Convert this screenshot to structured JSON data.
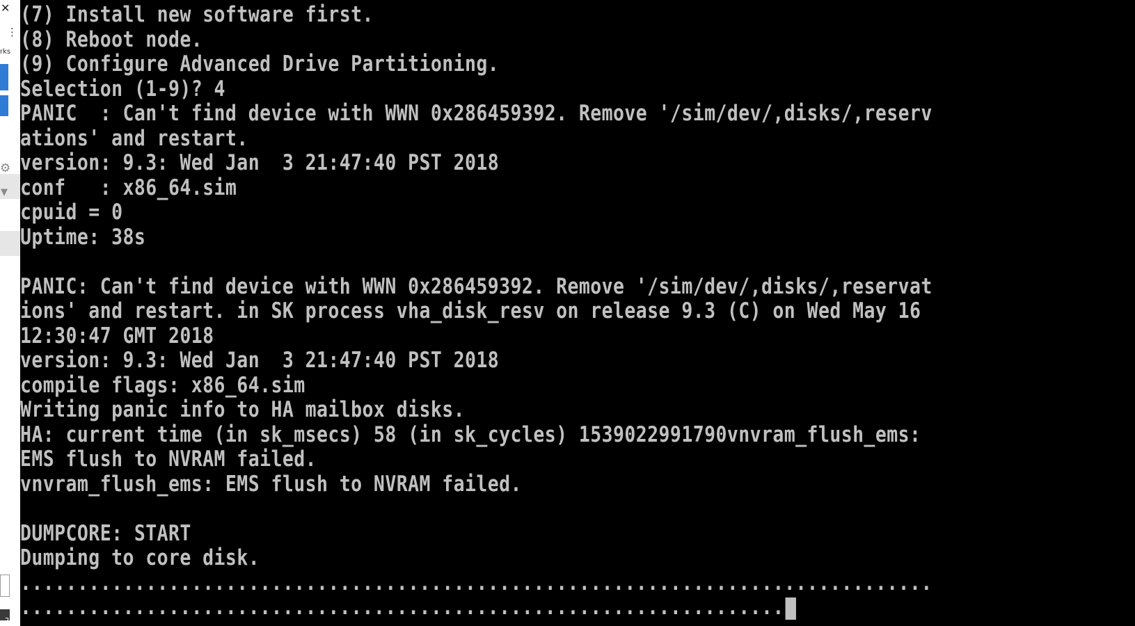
{
  "side_strip": {
    "close_glyph": "✕",
    "menu_glyph": "⋮",
    "label_fragment": "rks",
    "icons": [
      "close-icon",
      "kebab-menu-icon",
      "gear-icon",
      "filter-icon",
      "taskbar-app-icon"
    ],
    "taskbar_badge": "2"
  },
  "terminal": {
    "background": "#000000",
    "foreground": "#c0c0c0",
    "lines": [
      "(7) Install new software first.",
      "(8) Reboot node.",
      "(9) Configure Advanced Drive Partitioning.",
      "Selection (1-9)? 4",
      "PANIC  : Can't find device with WWN 0x286459392. Remove '/sim/dev/,disks/,reserv",
      "ations' and restart.",
      "version: 9.3: Wed Jan  3 21:47:40 PST 2018",
      "conf   : x86_64.sim",
      "cpuid = 0",
      "Uptime: 38s",
      "",
      "PANIC: Can't find device with WWN 0x286459392. Remove '/sim/dev/,disks/,reservat",
      "ions' and restart. in SK process vha_disk_resv on release 9.3 (C) on Wed May 16",
      "12:30:47 GMT 2018",
      "version: 9.3: Wed Jan  3 21:47:40 PST 2018",
      "compile flags: x86_64.sim",
      "Writing panic info to HA mailbox disks.",
      "HA: current time (in sk_msecs) 58 (in sk_cycles) 1539022991790vnvram_flush_ems:",
      "EMS flush to NVRAM failed.",
      "vnvram_flush_ems: EMS flush to NVRAM failed.",
      "",
      "DUMPCORE: START",
      "Dumping to core disk.",
      "................................................................................",
      "..................................................................."
    ]
  }
}
